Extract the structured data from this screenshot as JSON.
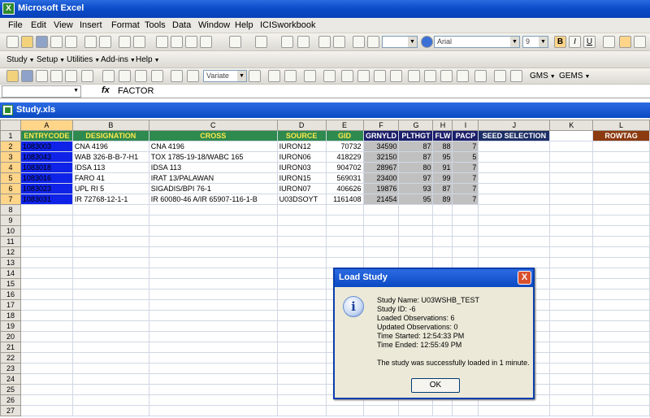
{
  "app": {
    "title": "Microsoft Excel"
  },
  "menu": [
    "File",
    "Edit",
    "View",
    "Insert",
    "Format",
    "Tools",
    "Data",
    "Window",
    "Help",
    "ICISworkbook"
  ],
  "toolbar_format": {
    "font": "Arial",
    "size": "9"
  },
  "toolbar_study": {
    "items": [
      "Study",
      "Setup",
      "Utilities",
      "Add-ins",
      "Help"
    ]
  },
  "toolbar_ici": {
    "variate": "Variate",
    "gms": "GMS",
    "gems": "GEMS"
  },
  "formula": {
    "namebox": "",
    "fx": "fx",
    "value": "FACTOR"
  },
  "workbook": {
    "name": "Study.xls"
  },
  "sheet": {
    "columns": [
      "A",
      "B",
      "C",
      "D",
      "E",
      "F",
      "G",
      "H",
      "I",
      "J",
      "K",
      "L"
    ],
    "headers": [
      "ENTRYCODE",
      "DESIGNATION",
      "CROSS",
      "SOURCE",
      "GID",
      "GRNYLD",
      "PLTHGT",
      "FLW",
      "PACP",
      "SEED SELECTION",
      "",
      "ROWTAG"
    ],
    "rows": [
      [
        "1083003",
        "CNA 4196",
        "CNA 4196",
        "IURON12",
        "70732",
        "34590",
        "87",
        "88",
        "7",
        "",
        "",
        ""
      ],
      [
        "1083043",
        "WAB 326-B-B-7-H1",
        "TOX 1785-19-18/WABC 165",
        "IURON06",
        "418229",
        "32150",
        "87",
        "95",
        "5",
        "",
        "",
        ""
      ],
      [
        "1083018",
        "IDSA 113",
        "IDSA 113",
        "IURON03",
        "904702",
        "28967",
        "80",
        "91",
        "7",
        "",
        "",
        ""
      ],
      [
        "1083016",
        "FARO 41",
        "IRAT 13/PALAWAN",
        "IURON15",
        "569031",
        "23400",
        "97",
        "99",
        "7",
        "",
        "",
        ""
      ],
      [
        "1083023",
        "UPL RI 5",
        "SIGADIS/BPI 76-1",
        "IURON07",
        "406626",
        "19876",
        "93",
        "87",
        "7",
        "",
        "",
        ""
      ],
      [
        "1083031",
        "IR 72768-12-1-1",
        "IR 60080-46 A/IR 65907-116-1-B",
        "U03DSOYT",
        "1161408",
        "21454",
        "95",
        "89",
        "7",
        "",
        "",
        ""
      ]
    ],
    "row_numbers": [
      "1",
      "2",
      "3",
      "4",
      "5",
      "6",
      "7",
      "8",
      "9",
      "10",
      "11",
      "12",
      "13",
      "14",
      "15",
      "16",
      "17",
      "18",
      "19",
      "20",
      "21",
      "22",
      "23",
      "24",
      "25",
      "26",
      "27"
    ]
  },
  "dialog": {
    "title": "Load Study",
    "close": "X",
    "study_name": "Study Name: U03WSHB_TEST",
    "study_id": "Study ID: -6",
    "loaded": "Loaded Observations: 6",
    "updated": "Updated Observations: 0",
    "started": "Time Started: 12:54:33 PM",
    "ended": "Time Ended: 12:55:49 PM",
    "message": "The study was successfully loaded in 1 minute.",
    "ok": "OK"
  }
}
